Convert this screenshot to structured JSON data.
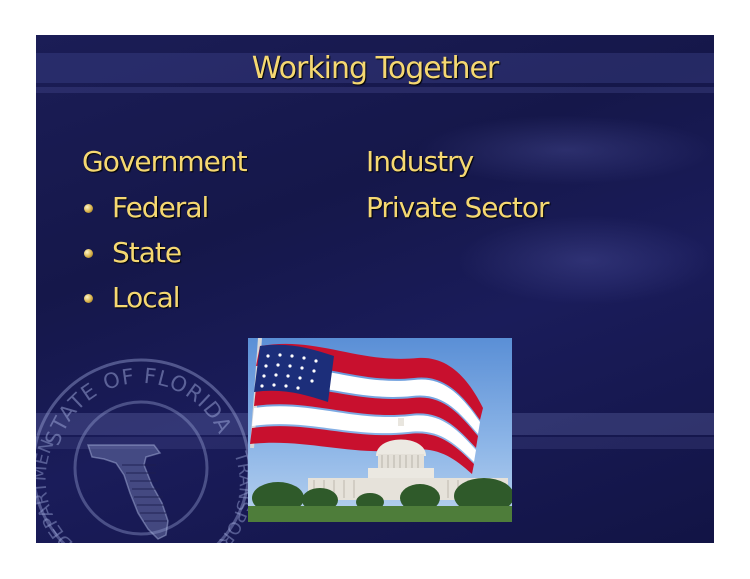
{
  "slide": {
    "title": "Working Together",
    "left_column": {
      "heading": "Government",
      "bullets": [
        "Federal",
        "State",
        "Local"
      ]
    },
    "right_column": {
      "items": [
        "Industry",
        "Private Sector"
      ]
    },
    "seal_text": {
      "top": "STATE OF FLORIDA",
      "left": "DEPARTMENT",
      "right": "TRANSPORTATION"
    }
  },
  "colors": {
    "slide_background": "#1b1d56",
    "text_gold": "#f5d872"
  },
  "images": {
    "photo": "us-flag-and-capitol-photo",
    "seal": "florida-dot-seal-watermark"
  }
}
